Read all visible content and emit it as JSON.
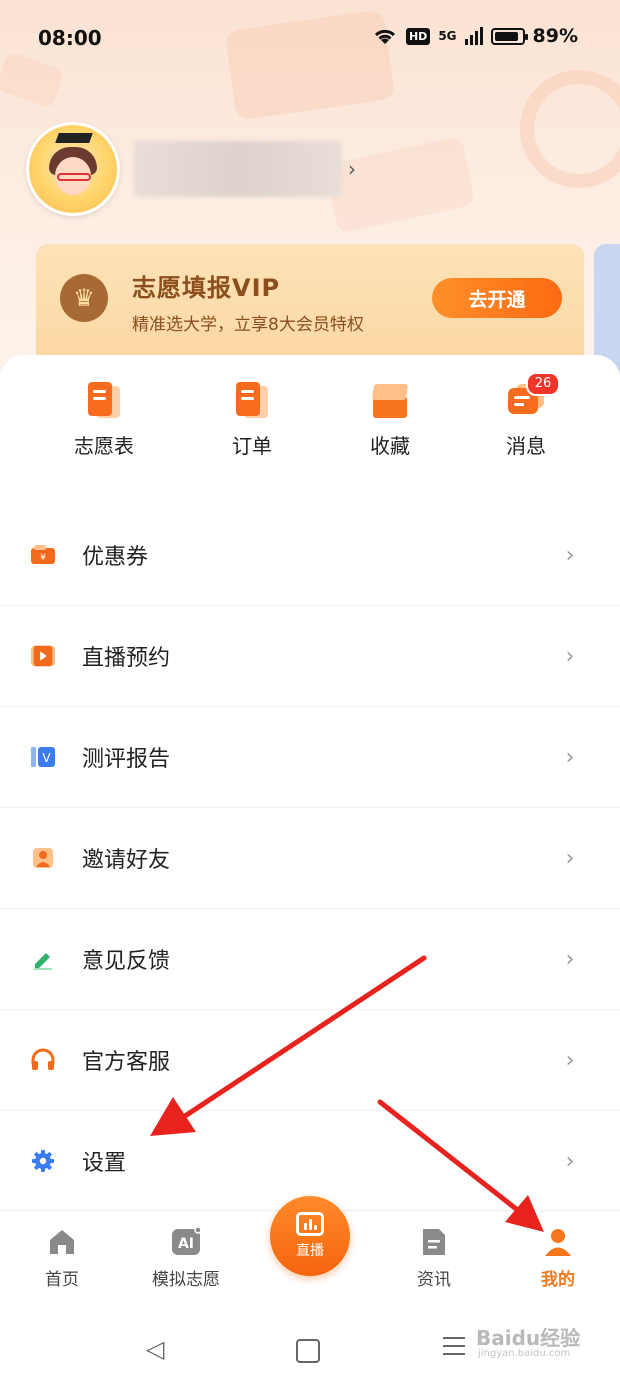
{
  "status_bar": {
    "time": "08:00",
    "network": "HD",
    "signal": "5G",
    "battery_percent": "89%",
    "battery_level": 0.89
  },
  "profile": {
    "chevron": "›"
  },
  "vip": {
    "title": "志愿填报VIP",
    "subtitle": "精准选大学，立享8大会员特权",
    "button": "去开通"
  },
  "quick_actions": [
    {
      "label": "志愿表",
      "icon": "document-icon"
    },
    {
      "label": "订单",
      "icon": "order-icon"
    },
    {
      "label": "收藏",
      "icon": "box-icon"
    },
    {
      "label": "消息",
      "icon": "message-icon",
      "badge": "26"
    }
  ],
  "menu": [
    {
      "label": "优惠券",
      "icon": "coupon-icon",
      "color": "#f26b1d"
    },
    {
      "label": "直播预约",
      "icon": "play-icon",
      "color": "#f26b1d"
    },
    {
      "label": "测评报告",
      "icon": "report-icon",
      "color": "#3b7cf0"
    },
    {
      "label": "邀请好友",
      "icon": "person-icon",
      "color": "#f26b1d"
    },
    {
      "label": "意见反馈",
      "icon": "pencil-icon",
      "color": "#2fb36a"
    },
    {
      "label": "官方客服",
      "icon": "headphones-icon",
      "color": "#f26b1d"
    },
    {
      "label": "设置",
      "icon": "gear-icon",
      "color": "#3b7cf0"
    }
  ],
  "tabs": [
    {
      "label": "首页",
      "icon": "home-icon",
      "active": false
    },
    {
      "label": "模拟志愿",
      "icon": "ai-icon",
      "active": false
    },
    {
      "label": "直播",
      "icon": "live-icon",
      "active": false
    },
    {
      "label": "资讯",
      "icon": "news-icon",
      "active": false
    },
    {
      "label": "我的",
      "icon": "profile-icon",
      "active": true
    }
  ],
  "nav": {
    "back": "◁"
  },
  "watermark": {
    "text": "Baidu经验",
    "sub": "jingyan.baidu.com"
  },
  "colors": {
    "accent": "#f5761c",
    "annotation_arrow": "#e8231e"
  }
}
